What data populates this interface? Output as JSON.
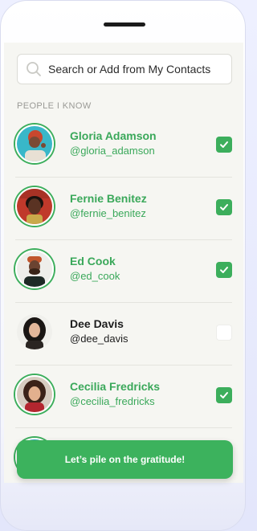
{
  "search": {
    "placeholder": "Search or Add from My Contacts"
  },
  "section_label": "PEOPLE I KNOW",
  "contacts": [
    {
      "name": "Gloria Adamson",
      "handle": "@gloria_adamson",
      "selected": true
    },
    {
      "name": "Fernie Benitez",
      "handle": "@fernie_benitez",
      "selected": true
    },
    {
      "name": "Ed Cook",
      "handle": "@ed_cook",
      "selected": true
    },
    {
      "name": "Dee Davis",
      "handle": "@dee_davis",
      "selected": false
    },
    {
      "name": "Cecilia Fredricks",
      "handle": "@cecilia_fredricks",
      "selected": true
    }
  ],
  "cta": {
    "label": "Let’s pile on the gratitude!"
  },
  "colors": {
    "accent": "#3cae5c",
    "background": "#f6f6f2",
    "text": "#1d1d1d"
  }
}
